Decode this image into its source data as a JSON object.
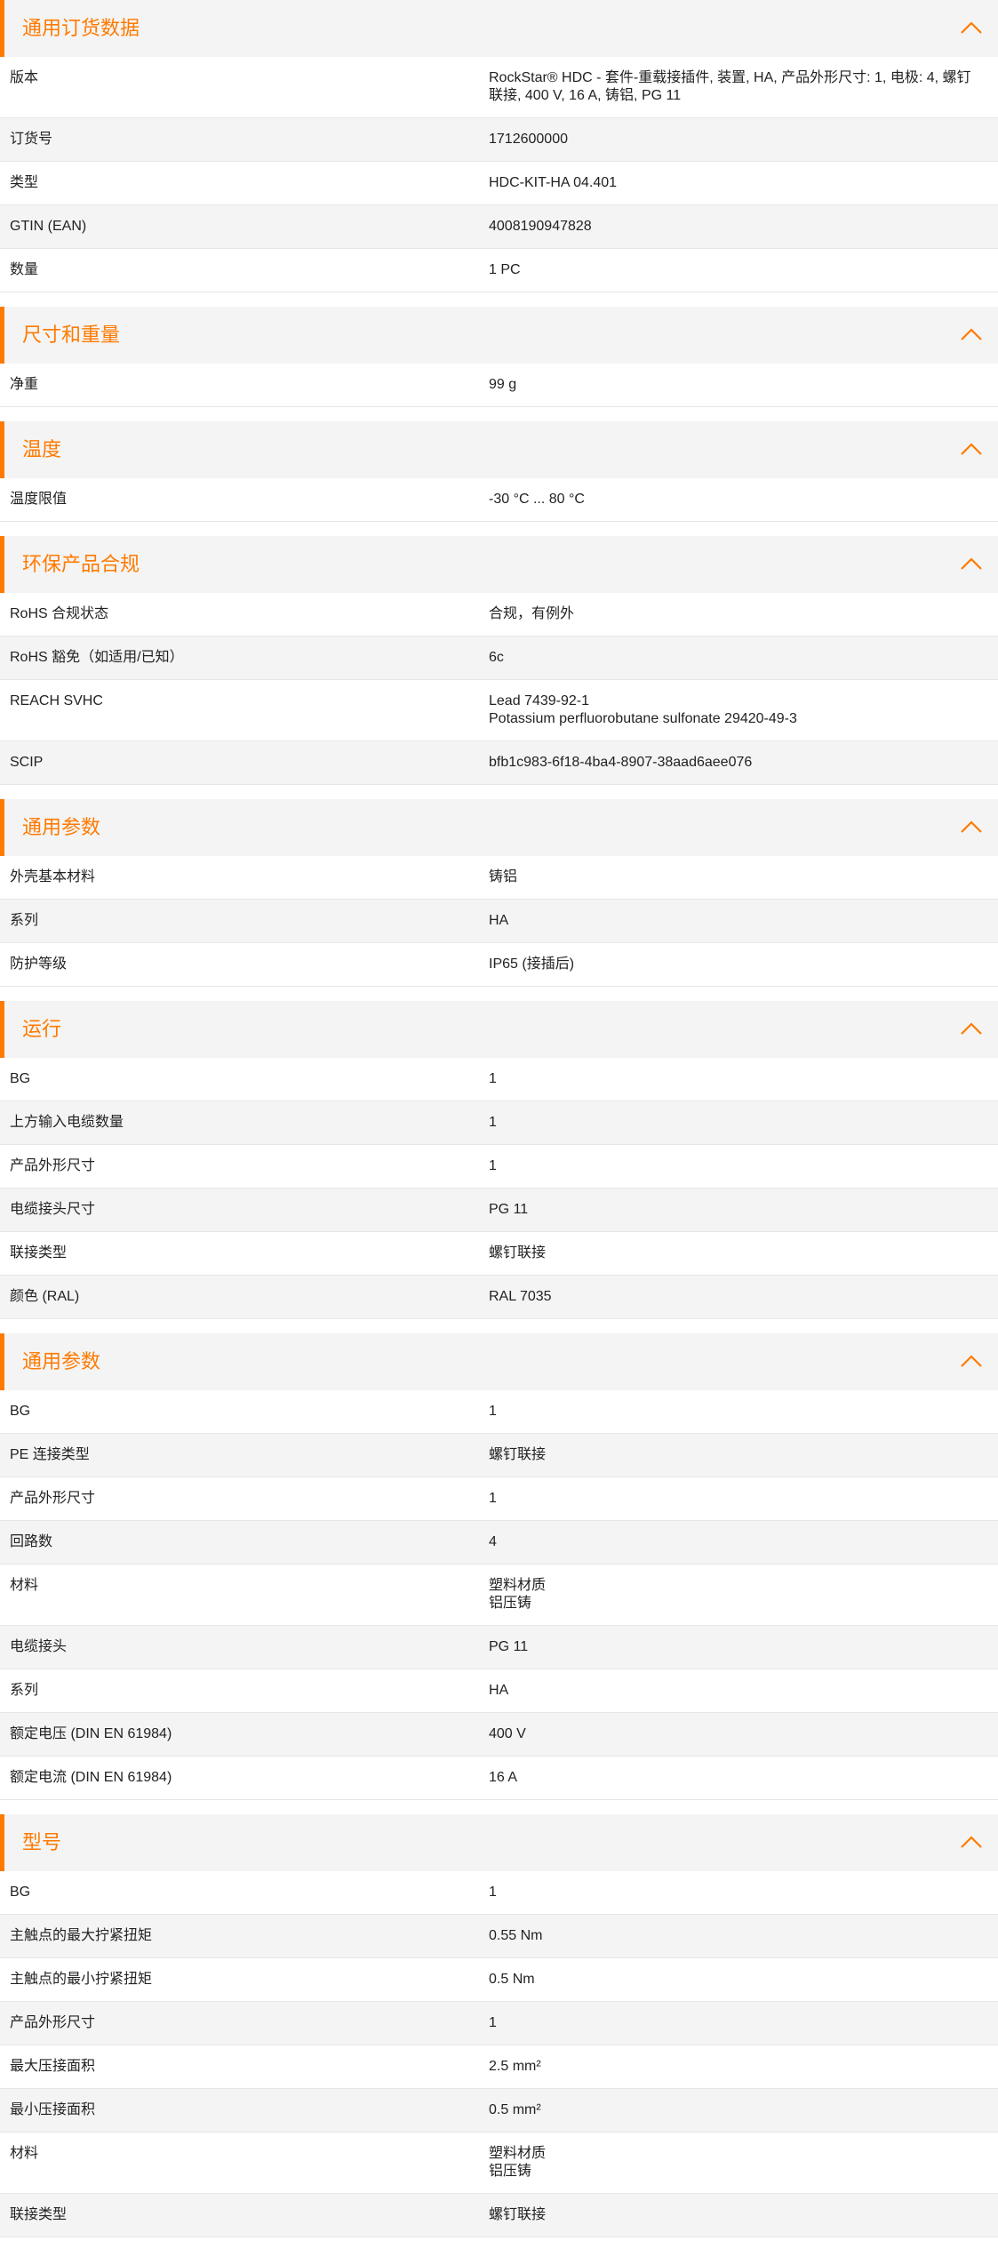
{
  "sections": [
    {
      "title": "通用订货数据",
      "rows": [
        {
          "label": "版本",
          "value": "RockStar® HDC - 套件-重载接插件, 装置, HA, 产品外形尺寸: 1, 电极: 4, 螺钉联接, 400 V, 16 A, 铸铝, PG 11"
        },
        {
          "label": "订货号",
          "value": "1712600000"
        },
        {
          "label": "类型",
          "value": "HDC-KIT-HA 04.401"
        },
        {
          "label": "GTIN (EAN)",
          "value": "4008190947828"
        },
        {
          "label": "数量",
          "value": "1  PC"
        }
      ]
    },
    {
      "title": "尺寸和重量",
      "rows": [
        {
          "label": "净重",
          "value": "99  g"
        }
      ]
    },
    {
      "title": "温度",
      "rows": [
        {
          "label": "温度限值",
          "value": "-30 °C ... 80 °C"
        }
      ]
    },
    {
      "title": "环保产品合规",
      "rows": [
        {
          "label": "RoHS 合规状态",
          "value": "合规，有例外"
        },
        {
          "label": "RoHS 豁免（如适用/已知）",
          "value": "6c"
        },
        {
          "label": "REACH SVHC",
          "value": "Lead 7439-92-1\nPotassium perfluorobutane sulfonate 29420-49-3"
        },
        {
          "label": "SCIP",
          "value": "bfb1c983-6f18-4ba4-8907-38aad6aee076"
        }
      ]
    },
    {
      "title": "通用参数",
      "rows": [
        {
          "label": "外壳基本材料",
          "value": "铸铝"
        },
        {
          "label": "系列",
          "value": "HA"
        },
        {
          "label": "防护等级",
          "value": "IP65 (接插后)"
        }
      ]
    },
    {
      "title": "运行",
      "rows": [
        {
          "label": "BG",
          "value": "1"
        },
        {
          "label": "上方输入电缆数量",
          "value": "1"
        },
        {
          "label": "产品外形尺寸",
          "value": "1"
        },
        {
          "label": "电缆接头尺寸",
          "value": "PG 11"
        },
        {
          "label": "联接类型",
          "value": "螺钉联接"
        },
        {
          "label": "颜色 (RAL)",
          "value": "RAL 7035"
        }
      ]
    },
    {
      "title": "通用参数",
      "rows": [
        {
          "label": "BG",
          "value": "1"
        },
        {
          "label": "PE 连接类型",
          "value": "螺钉联接"
        },
        {
          "label": "产品外形尺寸",
          "value": "1"
        },
        {
          "label": "回路数",
          "value": "4"
        },
        {
          "label": "材料",
          "value": "塑料材质\n铝压铸"
        },
        {
          "label": "电缆接头",
          "value": "PG 11"
        },
        {
          "label": "系列",
          "value": "HA"
        },
        {
          "label": "额定电压 (DIN EN 61984)",
          "value": "400  V"
        },
        {
          "label": "额定电流 (DIN EN 61984)",
          "value": "16  A"
        }
      ]
    },
    {
      "title": "型号",
      "rows": [
        {
          "label": "BG",
          "value": "1"
        },
        {
          "label": "主触点的最大拧紧扭矩",
          "value": "0.55  Nm"
        },
        {
          "label": "主触点的最小拧紧扭矩",
          "value": "0.5  Nm"
        },
        {
          "label": "产品外形尺寸",
          "value": "1"
        },
        {
          "label": "最大压接面积",
          "value": "2.5  mm²"
        },
        {
          "label": "最小压接面积",
          "value": "0.5  mm²"
        },
        {
          "label": "材料",
          "value": "塑料材质\n铝压铸"
        },
        {
          "label": "联接类型",
          "value": "螺钉联接"
        }
      ]
    }
  ],
  "icons": {
    "collapse": "chevron-up-icon"
  },
  "colors": {
    "accent": "#ff7a00",
    "stripe": "#f4f4f4",
    "text": "#222222"
  }
}
